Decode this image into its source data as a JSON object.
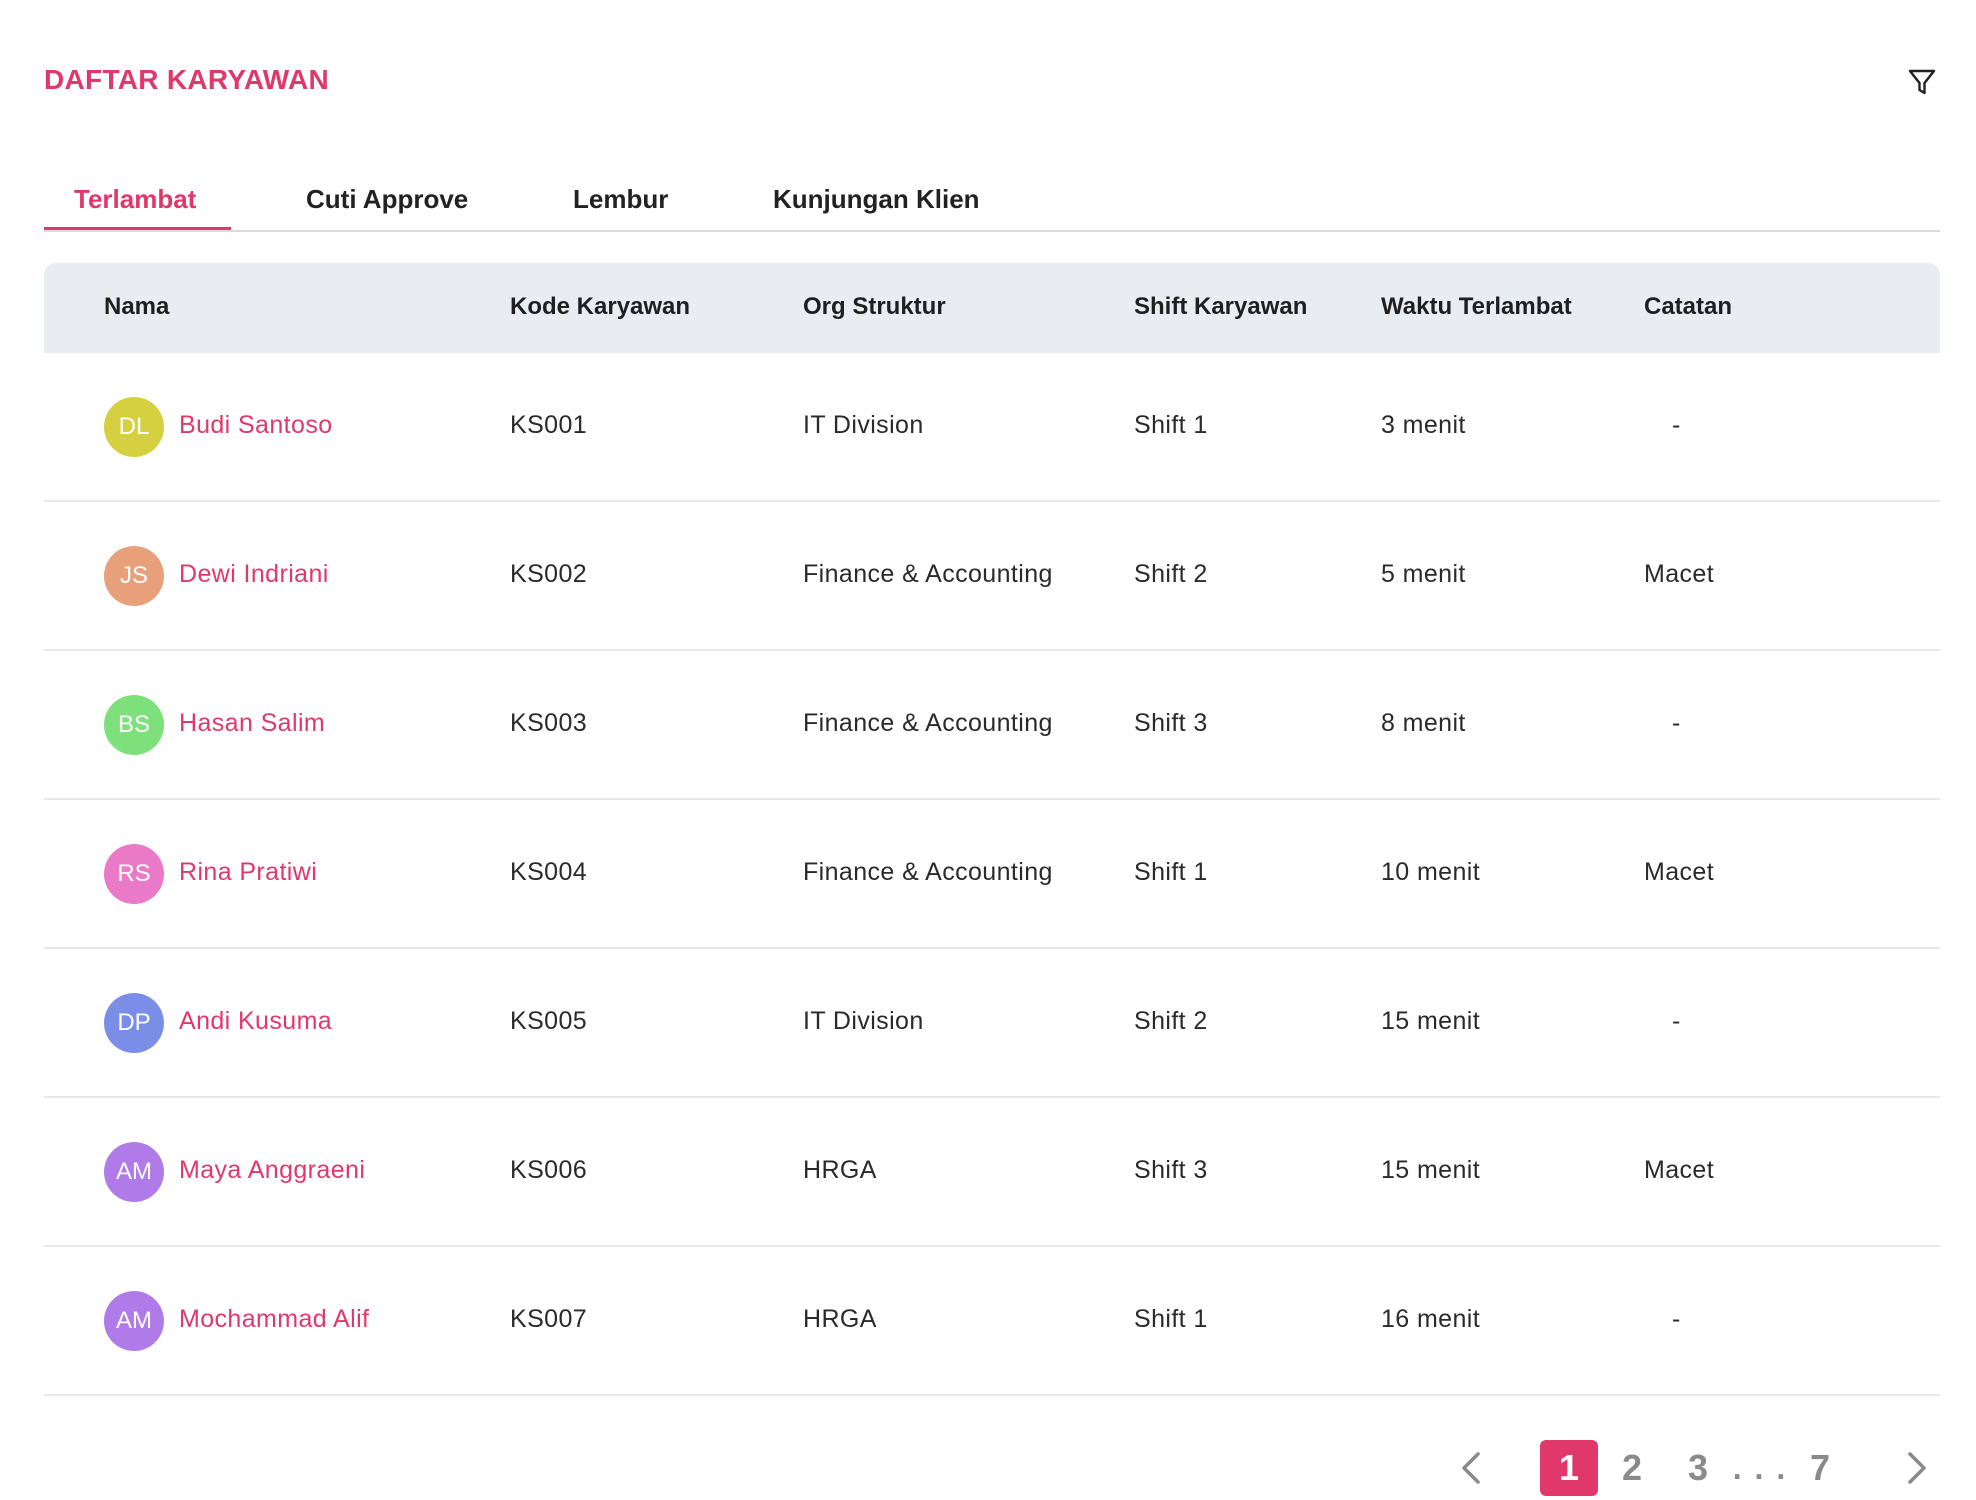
{
  "header": {
    "title": "DAFTAR KARYAWAN",
    "filter_icon": "filter-icon"
  },
  "tabs": [
    {
      "label": "Terlambat",
      "active": true
    },
    {
      "label": "Cuti Approve",
      "active": false
    },
    {
      "label": "Lembur",
      "active": false
    },
    {
      "label": "Kunjungan Klien",
      "active": false
    }
  ],
  "table": {
    "columns": [
      "Nama",
      "Kode Karyawan",
      "Org Struktur",
      "Shift Karyawan",
      "Waktu Terlambat",
      "Catatan"
    ],
    "rows": [
      {
        "initials": "DL",
        "avatar_color": "#d4d040",
        "name": "Budi Santoso",
        "kode": "KS001",
        "org": "IT Division",
        "shift": "Shift 1",
        "waktu": "3 menit",
        "catatan": "-"
      },
      {
        "initials": "JS",
        "avatar_color": "#e8a07a",
        "name": "Dewi Indriani",
        "kode": "KS002",
        "org": "Finance & Accounting",
        "shift": "Shift 2",
        "waktu": "5 menit",
        "catatan": "Macet"
      },
      {
        "initials": "BS",
        "avatar_color": "#7ee07a",
        "name": "Hasan Salim",
        "kode": "KS003",
        "org": "Finance & Accounting",
        "shift": "Shift 3",
        "waktu": "8 menit",
        "catatan": "-"
      },
      {
        "initials": "RS",
        "avatar_color": "#ea7ac8",
        "name": "Rina Pratiwi",
        "kode": "KS004",
        "org": "Finance & Accounting",
        "shift": "Shift 1",
        "waktu": "10 menit",
        "catatan": "Macet"
      },
      {
        "initials": "DP",
        "avatar_color": "#7a8ee8",
        "name": "Andi Kusuma",
        "kode": "KS005",
        "org": "IT Division",
        "shift": "Shift 2",
        "waktu": "15 menit",
        "catatan": "-"
      },
      {
        "initials": "AM",
        "avatar_color": "#b07ae8",
        "name": "Maya Anggraeni",
        "kode": "KS006",
        "org": "HRGA",
        "shift": "Shift 3",
        "waktu": "15 menit",
        "catatan": "Macet"
      },
      {
        "initials": "AM",
        "avatar_color": "#b07ae8",
        "name": "Mochammad Alif",
        "kode": "KS007",
        "org": "HRGA",
        "shift": "Shift 1",
        "waktu": "16 menit",
        "catatan": "-"
      }
    ]
  },
  "pagination": {
    "pages": [
      "1",
      "2",
      "3",
      "7"
    ],
    "ellipsis": ". . .",
    "current": "1"
  },
  "colors": {
    "accent": "#e0386a",
    "header_bg": "#e9ecf1"
  }
}
